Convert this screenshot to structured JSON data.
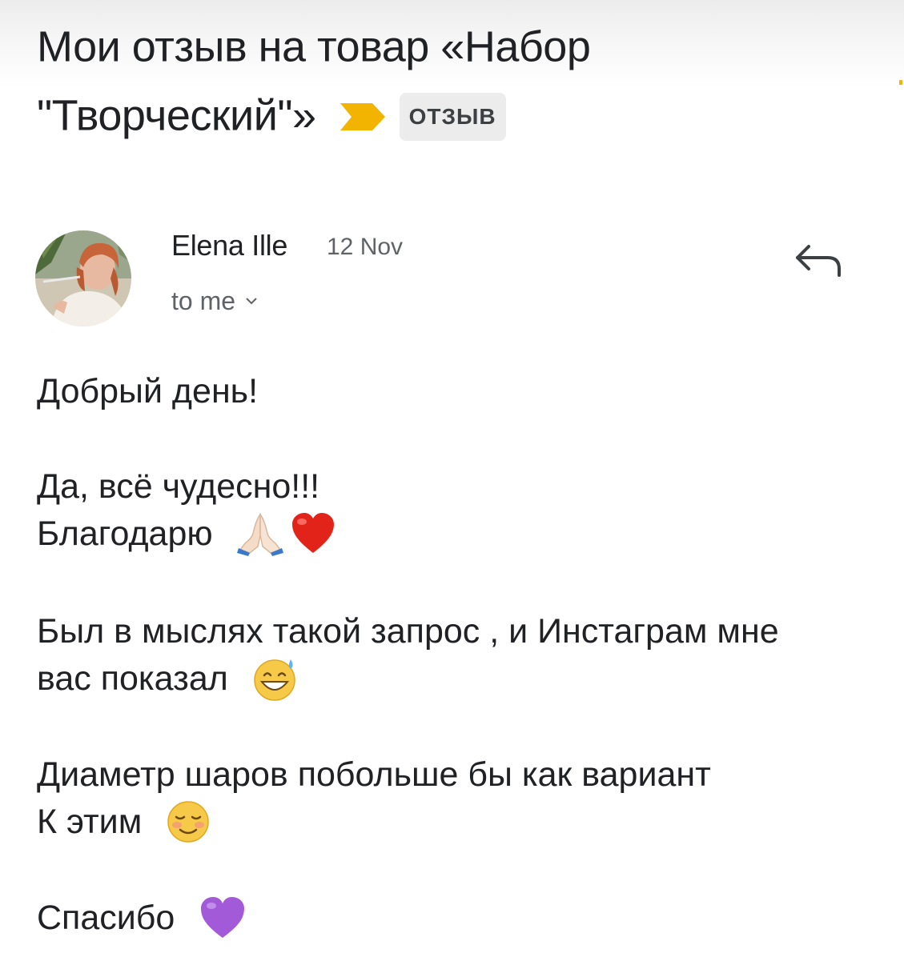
{
  "email": {
    "subject_line1": "Мои отзыв на товар «Набор",
    "subject_line2": "\"Творческий\"»",
    "label": "ОТЗЫВ",
    "sender_name": "Elena Ille",
    "date": "12 Nov",
    "recipient": "to me",
    "body_lines": [
      "Добрый день!",
      "Да, всё чудесно!!!",
      "Благодарю",
      "Был в мыслях такой запрос , и Инстаграм мне",
      "вас показал",
      "Диаметр шаров побольше бы как вариант",
      "К этим",
      "Спасибо"
    ]
  },
  "icons": {
    "importance": "importance-marker-icon",
    "reply": "reply-icon",
    "expand": "chevron-down-icon",
    "emoji_1": "folded-hands-emoji",
    "emoji_2": "red-heart-emoji",
    "emoji_3": "grinning-sweat-emoji",
    "emoji_4": "smiling-face-emoji",
    "emoji_5": "purple-heart-emoji"
  },
  "colors": {
    "importance": "#f2b400",
    "label_bg": "#ececec",
    "text": "#202124",
    "secondary_text": "#5f6368"
  }
}
